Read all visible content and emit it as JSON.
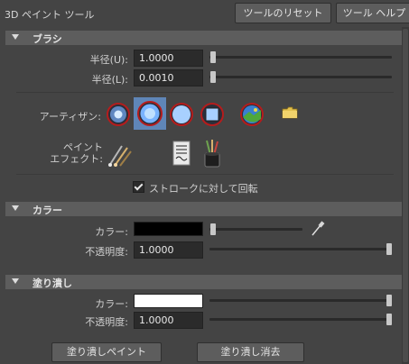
{
  "header": {
    "title": "3D ペイント ツール",
    "reset_button": "ツールのリセット",
    "help_button": "ツール ヘルプ"
  },
  "brush": {
    "section_title": "ブラシ",
    "radius_u_label": "半径(U):",
    "radius_u_value": "1.0000",
    "radius_l_label": "半径(L):",
    "radius_l_value": "0.0010",
    "artisan_label": "アーティザン:",
    "paint_effects_label": "ペイント\nエフェクト:",
    "stroke_checkbox_label": "ストロークに対して回転",
    "stroke_checked": true,
    "radius_u_level": 0.0,
    "radius_l_level": 0.0
  },
  "color": {
    "section_title": "カラー",
    "color_label": "カラー:",
    "color_value": "#000000",
    "opacity_label": "不透明度:",
    "opacity_value": "1.0000",
    "color_level": 0.0,
    "opacity_level": 1.0
  },
  "flood": {
    "section_title": "塗り潰し",
    "color_label": "カラー:",
    "color_value": "#ffffff",
    "opacity_label": "不透明度:",
    "opacity_value": "1.0000",
    "color_level": 1.0,
    "opacity_level": 1.0,
    "flood_paint_button": "塗り潰しペイント",
    "flood_erase_button": "塗り潰し消去"
  },
  "icons": {
    "artisan": [
      "soft-brush-icon",
      "selected-soft-brush-icon",
      "round-brush-icon",
      "square-brush-icon",
      "image-brush-icon",
      "folder-icon"
    ],
    "paint_effects": [
      "paint-brushes-icon",
      "document-icon",
      "paint-bucket-brushes-icon"
    ]
  }
}
